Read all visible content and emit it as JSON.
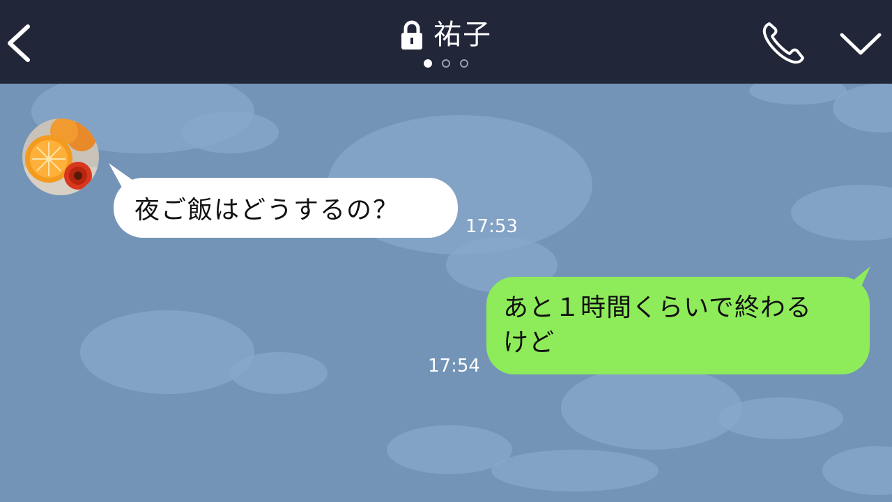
{
  "header": {
    "title": "祐子",
    "back_icon": "chevron-left-icon",
    "lock_icon": "lock-icon",
    "call_icon": "phone-icon",
    "menu_icon": "chevron-down-icon",
    "pager": {
      "count": 3,
      "active": 1
    }
  },
  "messages": [
    {
      "direction": "incoming",
      "text": "夜ご飯はどうするの？",
      "time": "17:53"
    },
    {
      "direction": "outgoing",
      "text_line1": "あと１時間くらいで終わる",
      "text_line2": "けど",
      "time": "17:54"
    }
  ],
  "colors": {
    "header_bg": "#222639",
    "chat_bg": "#7394b7",
    "incoming_bubble": "#ffffff",
    "outgoing_bubble": "#8eec5a"
  }
}
